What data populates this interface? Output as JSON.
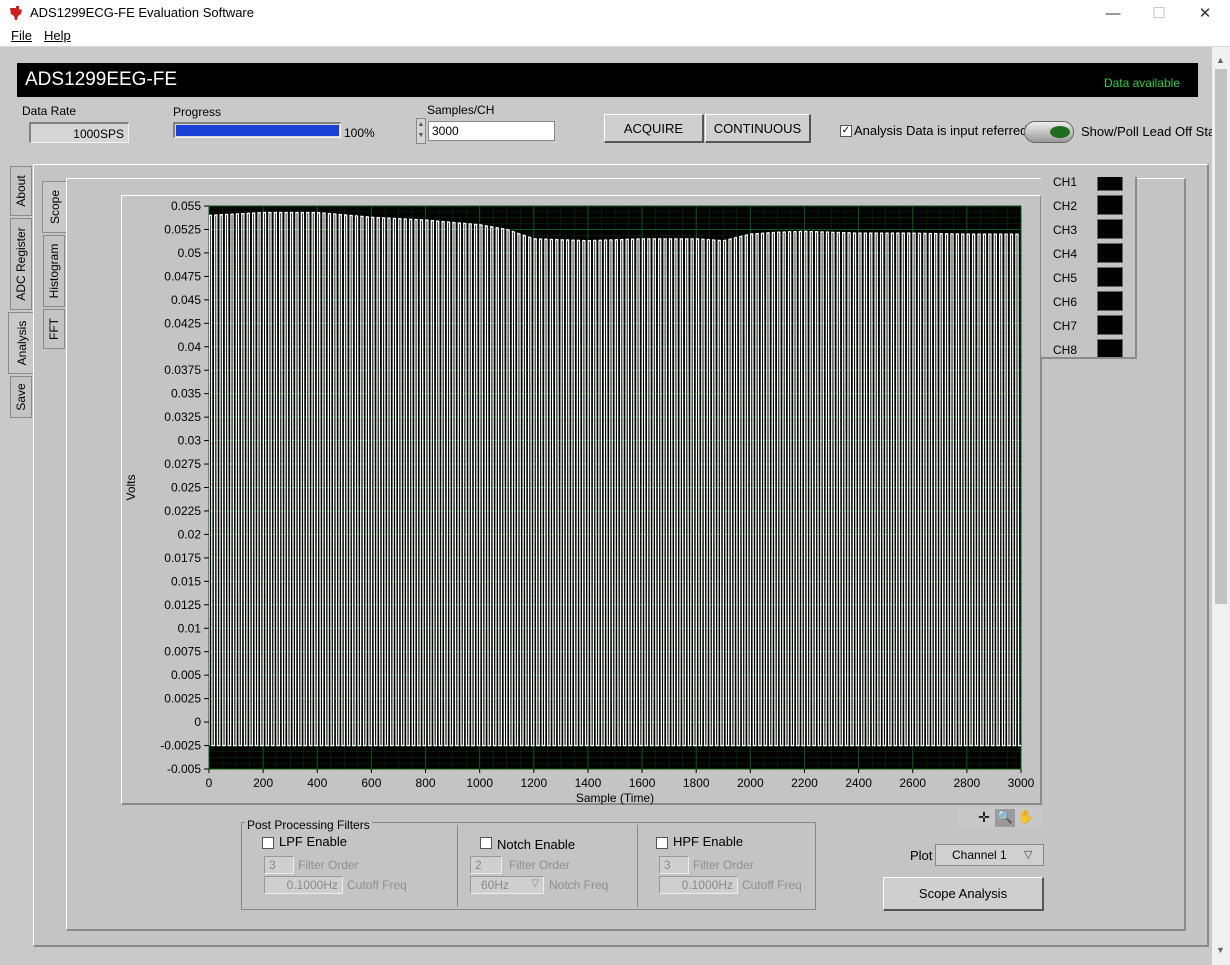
{
  "window": {
    "title": "ADS1299ECG-FE Evaluation Software",
    "minimize_glyph": "—",
    "maximize_glyph": "☐",
    "close_glyph": "✕"
  },
  "menu": {
    "file": "File",
    "help": "Help"
  },
  "header": {
    "device_name": "ADS1299EEG-FE",
    "status": "Data available",
    "status_color": "#2ecc40"
  },
  "controls": {
    "data_rate_label": "Data Rate",
    "data_rate_value": "1000SPS",
    "progress_label": "Progress",
    "progress_value": 100,
    "progress_text": "100%",
    "progress_color": "#1a3fd6",
    "samples_label": "Samples/CH",
    "samples_value": "3000",
    "acquire": "ACQUIRE",
    "continuous": "CONTINUOUS",
    "input_referred_label": "Analysis Data is input referred",
    "input_referred_checked": true,
    "lead_off_label": "Show/Poll Lead Off Status",
    "led_color": "#1f6b1f"
  },
  "tabs": {
    "about": "About",
    "adc_register": "ADC Register",
    "analysis": "Analysis",
    "save": "Save"
  },
  "subtabs": {
    "scope": "Scope",
    "histogram": "Histogram",
    "fft": "FFT"
  },
  "chart_data": {
    "type": "line",
    "ylabel": "Volts",
    "xlabel": "Sample (Time)",
    "xlim": [
      0,
      3000
    ],
    "ylim": [
      -0.005,
      0.055
    ],
    "x_ticks": [
      0,
      200,
      400,
      600,
      800,
      1000,
      1200,
      1400,
      1600,
      1800,
      2000,
      2200,
      2400,
      2600,
      2800,
      3000
    ],
    "y_ticks": [
      "0.055",
      "0.0525",
      "0.05",
      "0.0475",
      "0.045",
      "0.0425",
      "0.04",
      "0.0375",
      "0.035",
      "0.0325",
      "0.03",
      "0.0275",
      "0.025",
      "0.0225",
      "0.02",
      "0.0175",
      "0.015",
      "0.0125",
      "0.01",
      "0.0075",
      "0.005",
      "0.0025",
      "0",
      "-0.0025",
      "-0.005"
    ],
    "grid": true,
    "plot_background": "#000000",
    "grid_color": "#0b5a16",
    "series": [
      {
        "color": "#ffffff",
        "waveform_cycles": 150,
        "peak_envelope": [
          [
            0,
            0.054
          ],
          [
            200,
            0.0543
          ],
          [
            400,
            0.0543
          ],
          [
            600,
            0.0538
          ],
          [
            800,
            0.0535
          ],
          [
            1000,
            0.053
          ],
          [
            1100,
            0.0525
          ],
          [
            1200,
            0.0515
          ],
          [
            1400,
            0.0513
          ],
          [
            1600,
            0.0515
          ],
          [
            1800,
            0.0515
          ],
          [
            1900,
            0.0513
          ],
          [
            2000,
            0.052
          ],
          [
            2100,
            0.0522
          ],
          [
            2200,
            0.0523
          ],
          [
            2400,
            0.0521
          ],
          [
            2600,
            0.0521
          ],
          [
            2800,
            0.052
          ],
          [
            3000,
            0.052
          ]
        ],
        "trough_envelope": [
          [
            0,
            -0.0025
          ],
          [
            3000,
            -0.0025
          ]
        ]
      }
    ]
  },
  "legend": [
    "CH1",
    "CH2",
    "CH3",
    "CH4",
    "CH5",
    "CH6",
    "CH7",
    "CH8"
  ],
  "filters": {
    "group_label": "Post Processing Filters",
    "lpf": {
      "enable": "LPF Enable",
      "order": "3",
      "order_label": "Filter Order",
      "cutoff": "0.1000Hz",
      "cutoff_label": "Cutoff Freq"
    },
    "notch": {
      "enable": "Notch Enable",
      "order": "2",
      "order_label": "Filter Order",
      "freq": "60Hz",
      "freq_label": "Notch Freq"
    },
    "hpf": {
      "enable": "HPF Enable",
      "order": "3",
      "order_label": "Filter Order",
      "cutoff": "0.1000Hz",
      "cutoff_label": "Cutoff Freq"
    }
  },
  "plot": {
    "label": "Plot",
    "value": "Channel 1"
  },
  "scope_analysis": "Scope Analysis"
}
